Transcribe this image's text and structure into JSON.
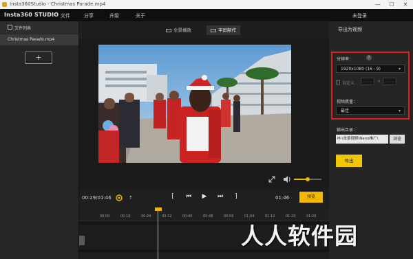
{
  "window": {
    "title": "Insta360Studio - Christmas Parade.mp4",
    "controls": {
      "minimize": "—",
      "maximize": "☐",
      "close": "✕"
    }
  },
  "menubar": {
    "logo": "Insta360 STUDIO",
    "items": [
      "文件",
      "分享",
      "升级",
      "关于"
    ],
    "login": "未登录"
  },
  "file_panel": {
    "header": "文件列表",
    "files": [
      "Christmas Parade.mp4"
    ],
    "add_label": "+"
  },
  "view_tabs": [
    {
      "label": "全景播放",
      "active": false
    },
    {
      "label": "平屏制作",
      "active": true
    }
  ],
  "playback": {
    "current_time": "00:29/01:46",
    "marker_label": "↑",
    "in_mark": "[",
    "prev": "⏮",
    "play": "▶",
    "next": "⏭",
    "out_mark": "]",
    "end_time": "01:46",
    "preview_label": "预览"
  },
  "volume": {
    "level": 0.5
  },
  "timeline": {
    "ticks": [
      "00:00",
      "00:16",
      "00:24",
      "00:32",
      "00:40",
      "00:48",
      "00:56",
      "01:04",
      "01:12",
      "01:20",
      "01:28"
    ],
    "playhead_time": "00:29"
  },
  "export_panel": {
    "title": "导出为视频",
    "resolution_label": "分辨率：",
    "help": "?",
    "resolution_value": "1920x1080 (16 : 9)",
    "custom_label": "自定义",
    "custom_width": "",
    "custom_sep": "×",
    "custom_height": "",
    "quality_label": "视频质量：",
    "quality_value": "最佳",
    "output_label": "输出目录：",
    "output_path": "M:\\全景视频\\Nano推广\\",
    "browse_label": "浏览",
    "export_label": "导出"
  },
  "watermark": "人人软件园",
  "colors": {
    "accent": "#f2b800",
    "highlight_box": "#e21d1d"
  }
}
